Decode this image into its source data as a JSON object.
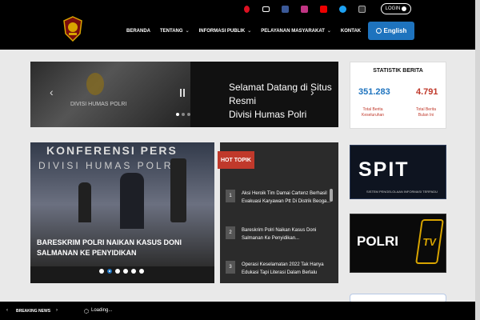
{
  "header": {
    "login_label": "LOGIN",
    "nav": [
      "BERANDA",
      "TENTANG",
      "INFORMASI PUBLIK",
      "PELAYANAN MASYARAKAT",
      "KONTAK"
    ],
    "nav_has_dropdown": [
      false,
      true,
      true,
      true,
      false
    ],
    "language_button": "English",
    "social_icons": [
      "phone-icon",
      "mail-icon",
      "facebook-icon",
      "instagram-icon",
      "youtube-icon",
      "twitter-icon",
      "tiktok-icon"
    ]
  },
  "hero": {
    "title_line1": "Selamat Datang di Situs Resmi",
    "title_line2": "Divisi Humas Polri"
  },
  "stats": {
    "title": "STATISTIK BERITA",
    "total": "351.283",
    "total_label_1": "Total Berita",
    "total_label_2": "Keseluruhan",
    "month": "4.791",
    "month_label_1": "Total Berita",
    "month_label_2": "Bulan Ini"
  },
  "feature": {
    "title_line1": "BARESKRIM POLRI NAIKAN KASUS DONI",
    "title_line2": "SALMANAN KE PENYIDIKAN",
    "bg_text_1": "DIVISI HUMAS POLRI",
    "bg_text_2": "KONFERENSI PERS"
  },
  "hot_topic": {
    "label": "HOT TOPIK",
    "items": [
      {
        "num": "1",
        "text": "Aksi Heroik Tim Damai Cartenz Berhasil Evakuasi Karyawan Ptt Di Distrik Beoga..."
      },
      {
        "num": "2",
        "text": "Bareskrim Polri Naikan Kasus Doni Salmanan Ke Penyidikan..."
      },
      {
        "num": "3",
        "text": "Operasi Keselamatan 2022 Tak Hanya Edukasi Tapi Literasi Dalam Berlalu"
      }
    ]
  },
  "banners": {
    "spit": "SPIT",
    "spit_sub": "SISTEM PENGELOLAAN INFORMASI TERPADU",
    "polri_tv": "POLRI",
    "tv": "TV"
  },
  "hero_slide_label": "DIVISI HUMAS POLRI",
  "footer": {
    "breaking": "BREAKING NEWS",
    "loading": "Loading..."
  },
  "colors": {
    "accent": "#1e73be",
    "red": "#c0392b",
    "dark": "#000000"
  }
}
